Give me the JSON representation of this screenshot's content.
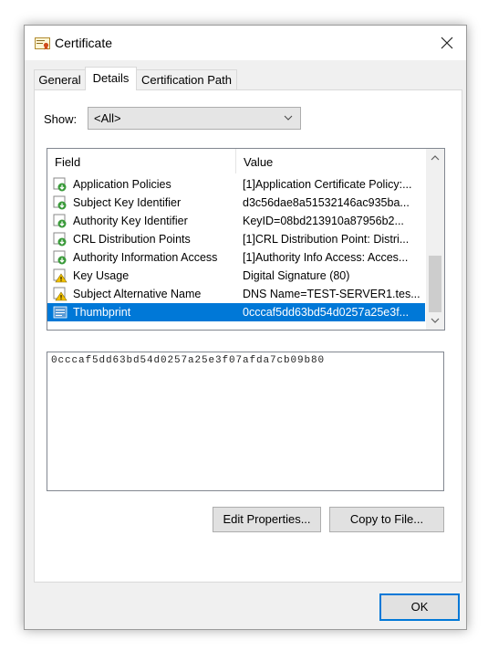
{
  "window": {
    "title": "Certificate",
    "icon": "certificate-icon",
    "close_icon": "close-icon"
  },
  "tabs": [
    {
      "label": "General",
      "active": false
    },
    {
      "label": "Details",
      "active": true
    },
    {
      "label": "Certification Path",
      "active": false
    }
  ],
  "show": {
    "label": "Show:",
    "selected": "<All>"
  },
  "fields_list": {
    "columns": [
      "Field",
      "Value"
    ],
    "rows": [
      {
        "field": "Application Policies",
        "value": "[1]Application Certificate Policy:...",
        "icon": "cert-extension-icon"
      },
      {
        "field": "Subject Key Identifier",
        "value": "d3c56dae8a51532146ac935ba...",
        "icon": "cert-extension-icon"
      },
      {
        "field": "Authority Key Identifier",
        "value": "KeyID=08bd213910a87956b2...",
        "icon": "cert-extension-icon"
      },
      {
        "field": "CRL Distribution Points",
        "value": "[1]CRL Distribution Point: Distri...",
        "icon": "cert-extension-icon"
      },
      {
        "field": "Authority Information Access",
        "value": "[1]Authority Info Access: Acces...",
        "icon": "cert-extension-icon"
      },
      {
        "field": "Key Usage",
        "value": "Digital Signature (80)",
        "icon": "critical-extension-icon"
      },
      {
        "field": "Subject Alternative Name",
        "value": "DNS Name=TEST-SERVER1.tes...",
        "icon": "critical-extension-icon"
      },
      {
        "field": "Thumbprint",
        "value": "0cccaf5dd63bd54d0257a25e3f...",
        "icon": "property-icon",
        "selected": true
      }
    ]
  },
  "value_box": {
    "text": "0cccaf5dd63bd54d0257a25e3f07afda7cb09b80"
  },
  "buttons": {
    "edit_properties": "Edit Properties...",
    "copy_to_file": "Copy to File...",
    "ok": "OK"
  },
  "colors": {
    "selection": "#0078d7",
    "dialog_bg": "#f0f0f0"
  }
}
